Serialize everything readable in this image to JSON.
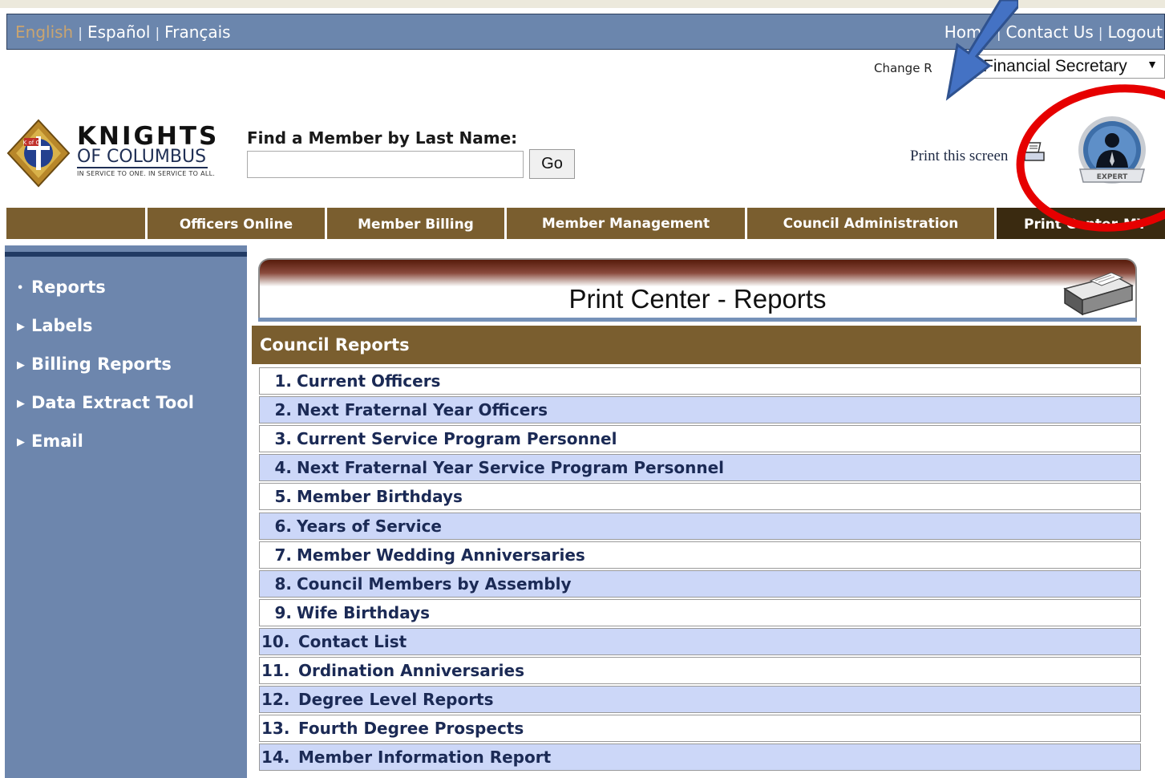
{
  "language_bar": {
    "languages": [
      "English",
      "Español",
      "Français"
    ],
    "links": [
      "Home",
      "Contact Us",
      "Logout"
    ]
  },
  "role": {
    "label": "Change R",
    "selected": "Financial Secretary"
  },
  "logo": {
    "word1": "KNIGHTS",
    "word2": "OF COLUMBUS",
    "tagline": "IN SERVICE TO ONE. IN SERVICE TO ALL."
  },
  "search": {
    "label": "Find a Member by Last Name:",
    "value": "",
    "go_label": "Go"
  },
  "print_screen": "Print this screen",
  "badge_text": "EXPERT",
  "nav": {
    "tabs": [
      "Officers Online",
      "Member Billing",
      "Member Management",
      "Council Administration",
      "Print Center-MY"
    ]
  },
  "sidebar": {
    "items": [
      "Reports",
      "Labels",
      "Billing Reports",
      "Data Extract Tool",
      "Email"
    ]
  },
  "panel_title": "Print Center - Reports",
  "section_title": "Council Reports",
  "reports": [
    {
      "num": "1.",
      "label": "Current Officers"
    },
    {
      "num": "2.",
      "label": "Next Fraternal Year Officers"
    },
    {
      "num": "3.",
      "label": "Current Service Program Personnel"
    },
    {
      "num": "4.",
      "label": "Next Fraternal Year Service Program Personnel"
    },
    {
      "num": "5.",
      "label": "Member Birthdays"
    },
    {
      "num": "6.",
      "label": "Years of Service"
    },
    {
      "num": "7.",
      "label": "Member Wedding Anniversaries"
    },
    {
      "num": "8.",
      "label": "Council Members by Assembly"
    },
    {
      "num": "9.",
      "label": "Wife Birthdays"
    },
    {
      "num": "10.",
      "label": "Contact List"
    },
    {
      "num": "11.",
      "label": "Ordination Anniversaries"
    },
    {
      "num": "12.",
      "label": "Degree Level Reports"
    },
    {
      "num": "13.",
      "label": "Fourth Degree Prospects"
    },
    {
      "num": "14.",
      "label": "Member Information Report"
    }
  ],
  "colors": {
    "lang_bar": "#6b86ad",
    "nav_brown": "#7a5e2f",
    "nav_active": "#3a2a10",
    "sidebar": "#6d86ad",
    "row_alt": "#ccd7f8",
    "annotation_red": "#e60000",
    "annotation_blue": "#4472c4"
  }
}
